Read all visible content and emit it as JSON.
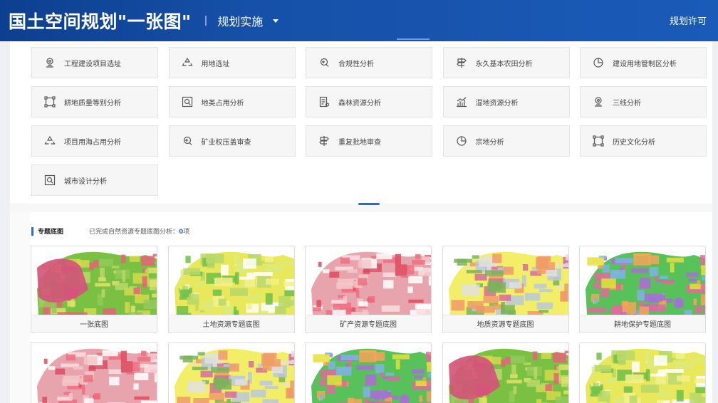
{
  "header": {
    "title": "国土空间规划\"一张图\"",
    "separator": "|",
    "menu_label": "规划实施",
    "right_link": "规划许可"
  },
  "tools": [
    {
      "label": "工程建设项目选址",
      "icon": "location-pin-icon"
    },
    {
      "label": "用地选址",
      "icon": "recycle-icon"
    },
    {
      "label": "合规性分析",
      "icon": "search-refresh-icon"
    },
    {
      "label": "永久基本农田分析",
      "icon": "signpost-icon"
    },
    {
      "label": "建设用地管制区分析",
      "icon": "pie-chart-icon"
    },
    {
      "label": "耕地质量等别分析",
      "icon": "frame-select-icon"
    },
    {
      "label": "地类占用分析",
      "icon": "search-box-icon"
    },
    {
      "label": "森林资源分析",
      "icon": "list-document-icon"
    },
    {
      "label": "湿地资源分析",
      "icon": "bar-chart-icon"
    },
    {
      "label": "三线分析",
      "icon": "location-pin-icon"
    },
    {
      "label": "项目用海占用分析",
      "icon": "recycle-icon"
    },
    {
      "label": "矿业权压盖审查",
      "icon": "search-refresh-icon"
    },
    {
      "label": "重复批地审查",
      "icon": "signpost-icon"
    },
    {
      "label": "宗地分析",
      "icon": "pie-chart-icon"
    },
    {
      "label": "历史文化分析",
      "icon": "frame-select-icon"
    },
    {
      "label": "城市设计分析",
      "icon": "search-box-icon"
    }
  ],
  "section": {
    "title": "专题底图",
    "status_prefix": "已完成自然资源专题底图分析：",
    "status_count": "0",
    "status_suffix": "项"
  },
  "maps": [
    {
      "caption": "一张底图"
    },
    {
      "caption": "土地资源专题底图"
    },
    {
      "caption": "矿产资源专题底图"
    },
    {
      "caption": "地质资源专题底图"
    },
    {
      "caption": "耕地保护专题底图"
    },
    {
      "caption": ""
    },
    {
      "caption": ""
    },
    {
      "caption": ""
    },
    {
      "caption": ""
    },
    {
      "caption": ""
    }
  ],
  "colors": {
    "header_start": "#0d3f8f",
    "header_end": "#1a5bb8",
    "accent": "#2a6dd0"
  }
}
